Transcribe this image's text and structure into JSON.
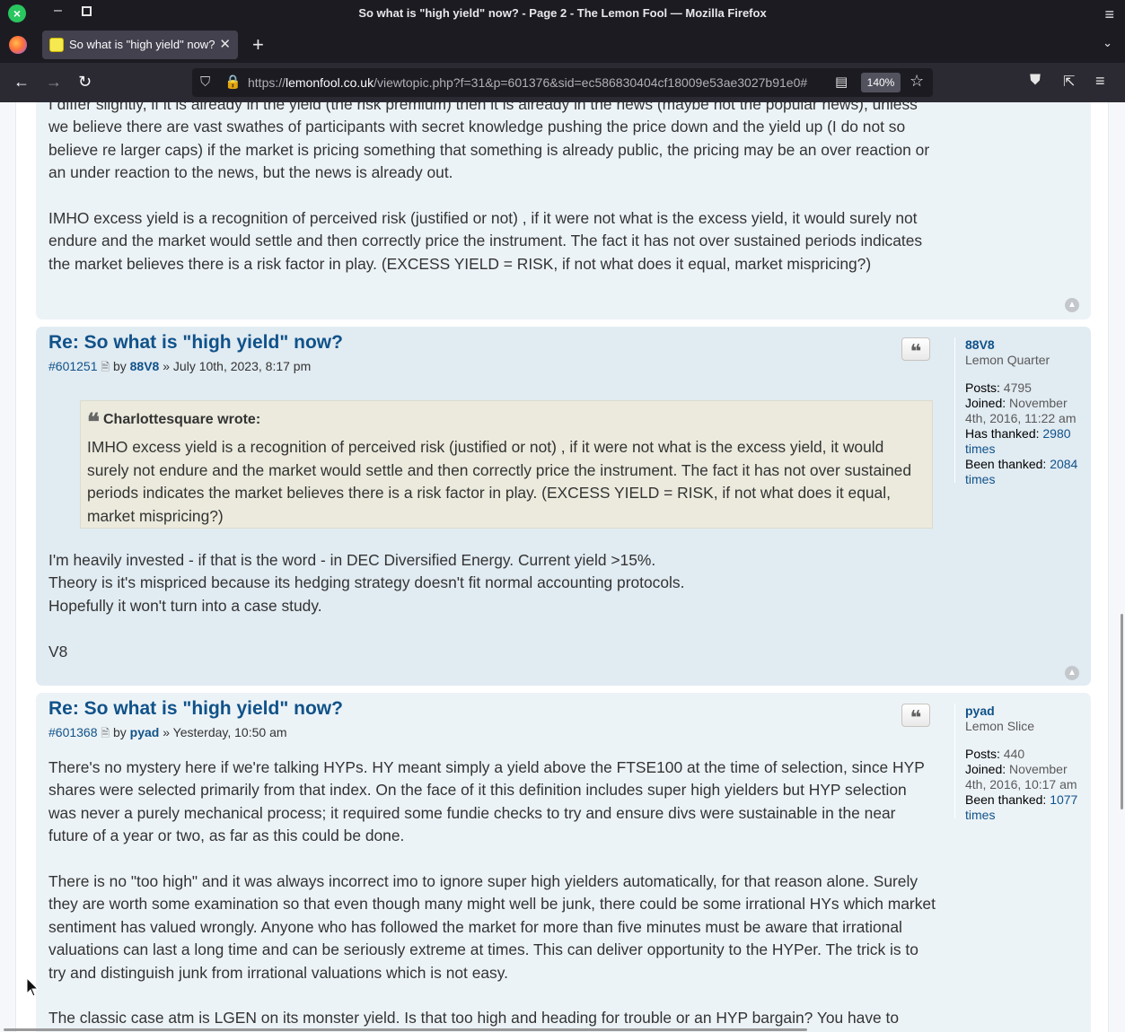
{
  "browser": {
    "window_title": "So what is \"high yield\" now? - Page 2 - The Lemon Fool — Mozilla Firefox",
    "tab_title": "So what is \"high yield\" now? - Page 2",
    "url_prefix": "https://",
    "url_host": "lemonfool.co.uk",
    "url_path": "/viewtopic.php?f=31&p=601376&sid=ec586830404cf18009e53ae3027b91e0#",
    "zoom": "140%",
    "icons": {
      "close": "×",
      "minimize": "–",
      "menu": "≡",
      "tab_close": "✕",
      "new_tab": "+",
      "tab_list": "⌄",
      "back": "←",
      "forward": "→",
      "reload": "↻",
      "shield": "⛉",
      "lock": "🔒",
      "reader": "▤",
      "star": "☆",
      "pocket": "⛊",
      "extensions": "⇱",
      "app_menu": "≡"
    }
  },
  "forum": {
    "quote_icon": "❝",
    "back_to_top_icon": "▲",
    "post_icon": "🗎",
    "prev_post": {
      "paragraphs": [
        "I differ slightly, if it is already in the yield (the risk premium) then it is already in the news (maybe not the popular news), unless we believe there are vast swathes of participants with secret knowledge pushing the price down and the yield up (I do not so believe re larger caps) if the market is pricing something that something is already public, the pricing may be an over reaction or an under reaction to the news, but the news is already out.",
        "IMHO excess yield is a recognition of perceived risk (justified or not) , if it were not what is the excess yield, it would surely not endure and the market would settle and then correctly price the instrument. The fact it has not over sustained periods indicates the market believes there is a risk factor in play. (EXCESS YIELD = RISK, if not what does it equal, market mispricing?)"
      ]
    },
    "post1": {
      "title": "Re: So what is \"high yield\" now?",
      "post_id": "#601251",
      "by": "by",
      "author": "88V8",
      "date_sep": "»",
      "date": "July 10th, 2023, 8:17 pm",
      "quote_author": "Charlottesquare wrote:",
      "quote_text": "IMHO excess yield is a recognition of perceived risk (justified or not) , if it were not what is the excess yield, it would surely not endure and the market would settle and then correctly price the instrument. The fact it has not over sustained periods indicates the market believes there is a risk factor in play. (EXCESS YIELD = RISK, if not what does it equal, market mispricing?)",
      "lines": [
        "I'm heavily invested - if that is the word - in DEC Diversified Energy. Current yield >15%.",
        "Theory is it's mispriced because its hedging strategy doesn't fit normal accounting protocols.",
        "Hopefully it won't turn into a case study."
      ],
      "signoff": "V8",
      "profile": {
        "username": "88V8",
        "rank": "Lemon Quarter",
        "posts_label": "Posts:",
        "posts": "4795",
        "joined_label": "Joined:",
        "joined": "November 4th, 2016, 11:22 am",
        "has_thanked_label": "Has thanked:",
        "has_thanked": "2980 times",
        "been_thanked_label": "Been thanked:",
        "been_thanked": "2084 times"
      }
    },
    "post2": {
      "title": "Re: So what is \"high yield\" now?",
      "post_id": "#601368",
      "by": "by",
      "author": "pyad",
      "date_sep": "»",
      "date": "Yesterday, 10:50 am",
      "paragraphs": [
        "There's no mystery here if we're talking HYPs. HY meant simply a yield above the FTSE100 at the time of selection, since HYP shares were selected primarily from that index. On the face of it this definition includes super high yielders but HYP selection was never a purely mechanical process; it required some fundie checks to try and ensure divs were sustainable in the near future of a year or two, as far as this could be done.",
        "There is no \"too high\" and it was always incorrect imo to ignore super high yielders automatically, for that reason alone. Surely they are worth some examination so that even though many might well be junk, there could be some irrational HYs which market sentiment has valued wrongly. Anyone who has followed the market for more than five minutes must be aware that irrational valuations can last a long time and can be seriously extreme at times. This can deliver opportunity to the HYPer. The trick is to try and distinguish junk from irrational valuations which is not easy.",
        "The classic case atm is LGEN on its monster yield. Is that too high and heading for trouble or an HYP bargain? You have to"
      ],
      "profile": {
        "username": "pyad",
        "rank": "Lemon Slice",
        "posts_label": "Posts:",
        "posts": "440",
        "joined_label": "Joined:",
        "joined": "November 4th, 2016, 10:17 am",
        "been_thanked_label": "Been thanked:",
        "been_thanked": "1077 times"
      }
    }
  }
}
